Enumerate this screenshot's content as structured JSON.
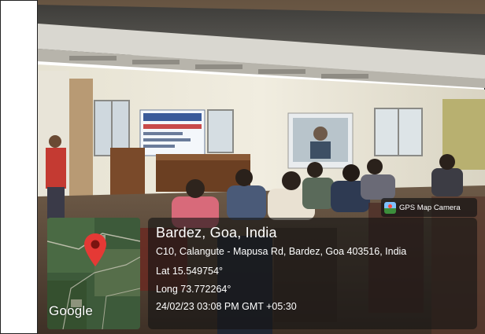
{
  "photo": {
    "badge_label": "GPS Map Camera"
  },
  "location": {
    "title": "Bardez, Goa, India",
    "address": "C10, Calangute - Mapusa Rd, Bardez, Goa 403516, India",
    "latitude": "Lat 15.549754°",
    "longitude": "Long 73.772264°",
    "timestamp": "24/02/23 03:08 PM GMT +05:30"
  },
  "map": {
    "provider_label": "Google",
    "marker_icon": "map-pin-icon"
  },
  "colors": {
    "marker": "#e53935",
    "panel_background": "#141414",
    "text": "#ffffff"
  }
}
